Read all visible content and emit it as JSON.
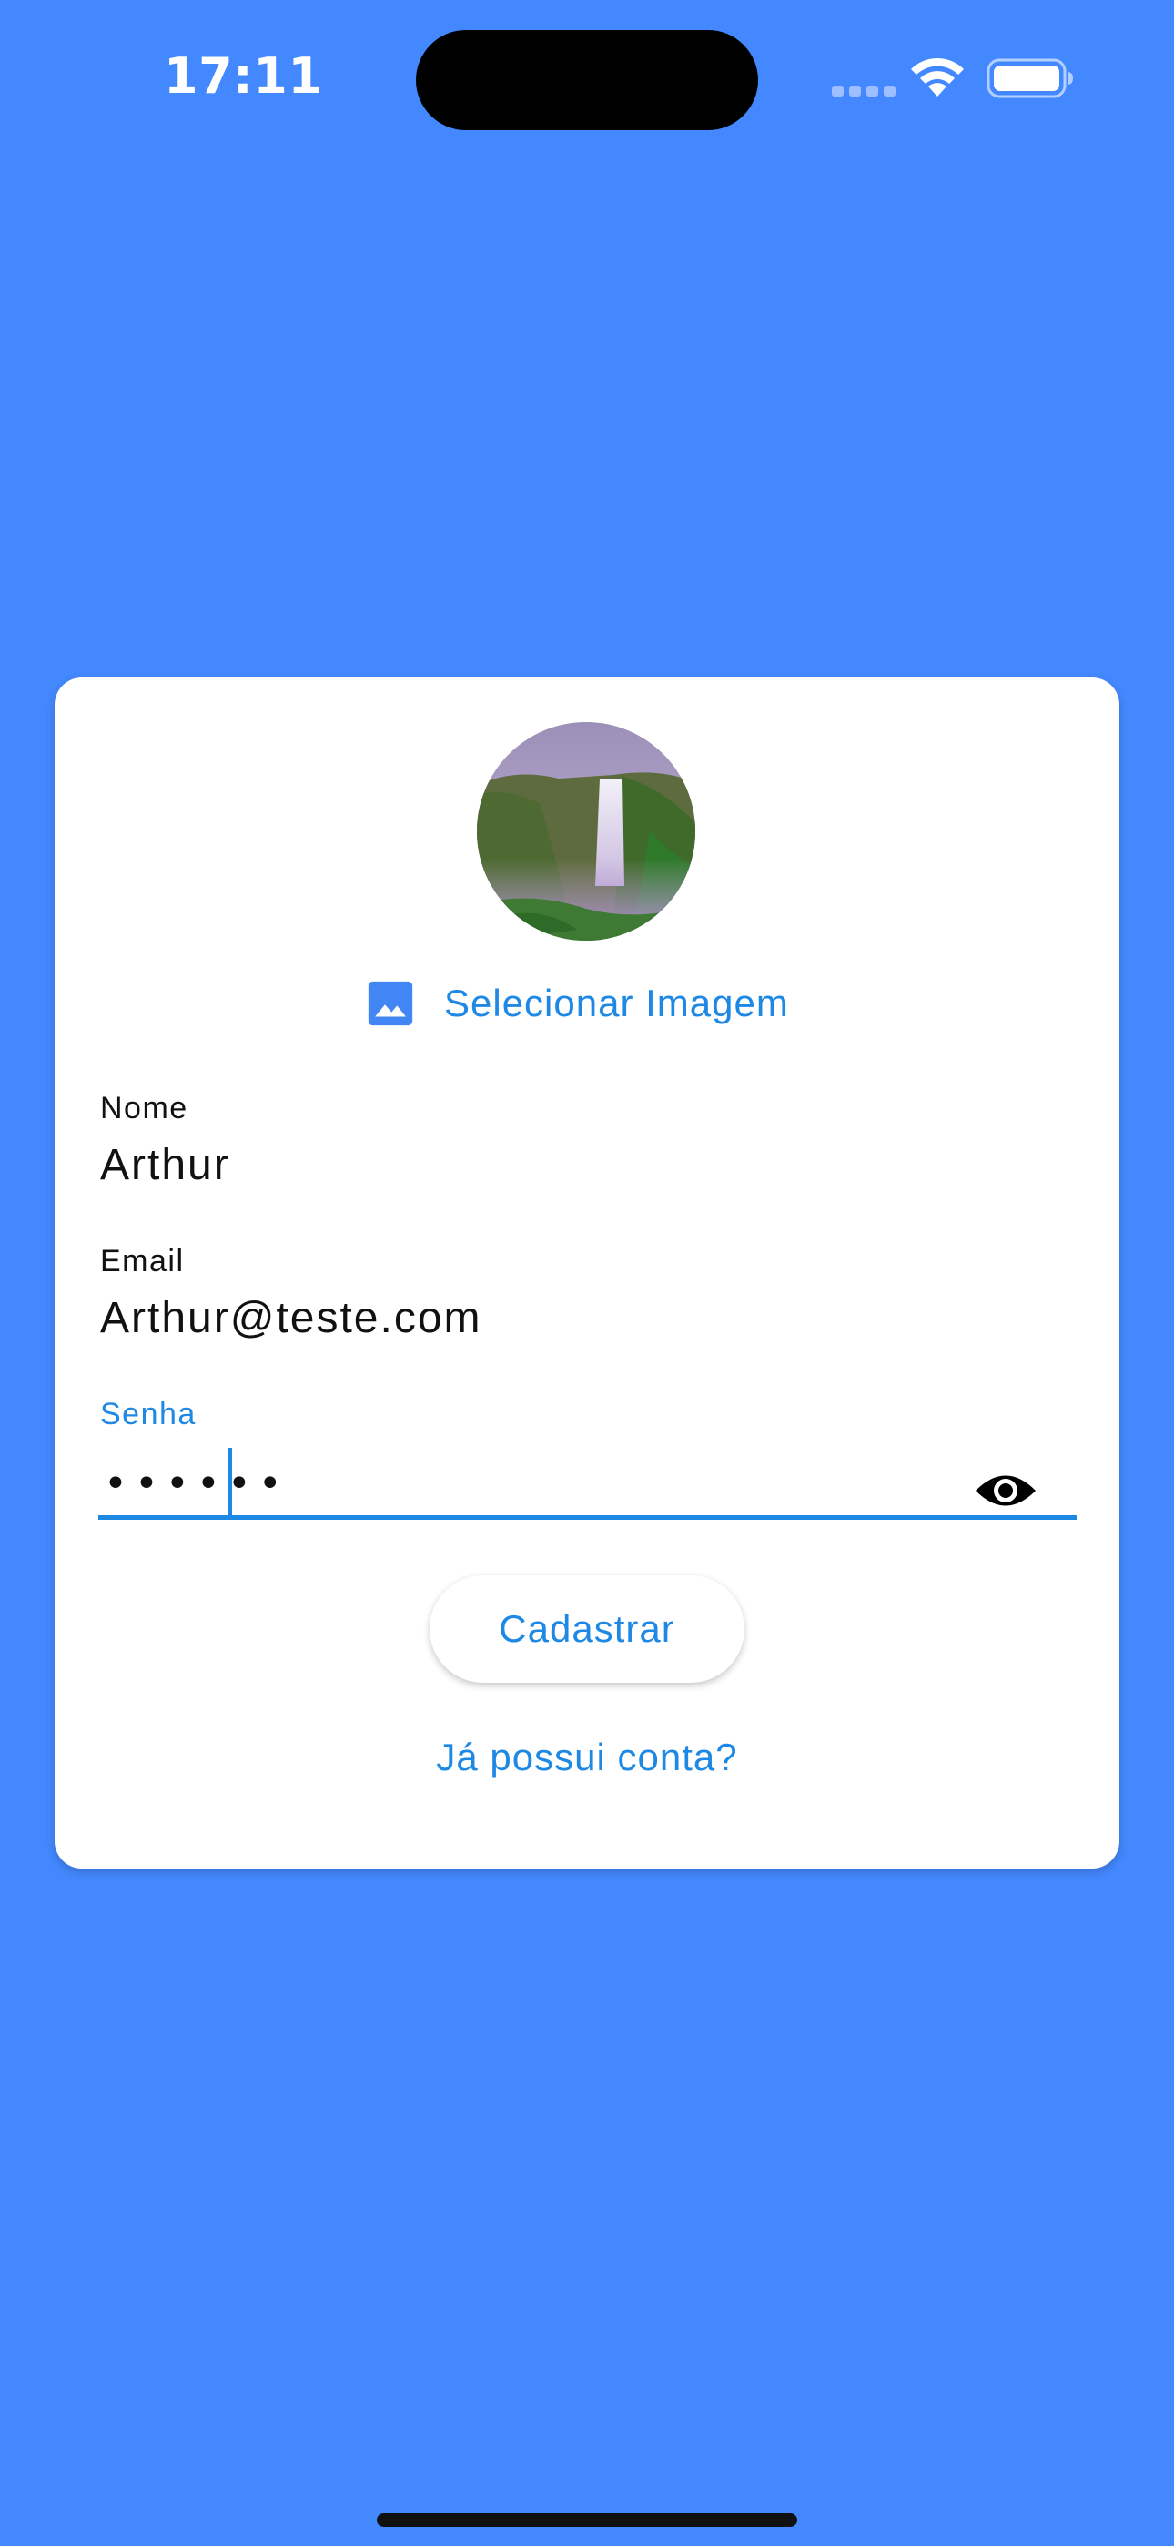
{
  "status_bar": {
    "time": "17:11"
  },
  "form": {
    "avatar_icon": "waterfall-photo",
    "select_image": {
      "icon": "image-icon",
      "label": "Selecionar Imagem"
    },
    "name": {
      "label": "Nome",
      "value": "Arthur"
    },
    "email": {
      "label": "Email",
      "value": "Arthur@teste.com"
    },
    "password": {
      "label": "Senha",
      "value": "••••••",
      "toggle_icon": "eye-icon"
    },
    "submit_label": "Cadastrar",
    "login_link": "Já possui conta?"
  },
  "colors": {
    "background": "#4388FE",
    "accent": "#1E88E5",
    "card": "#FFFFFF"
  }
}
